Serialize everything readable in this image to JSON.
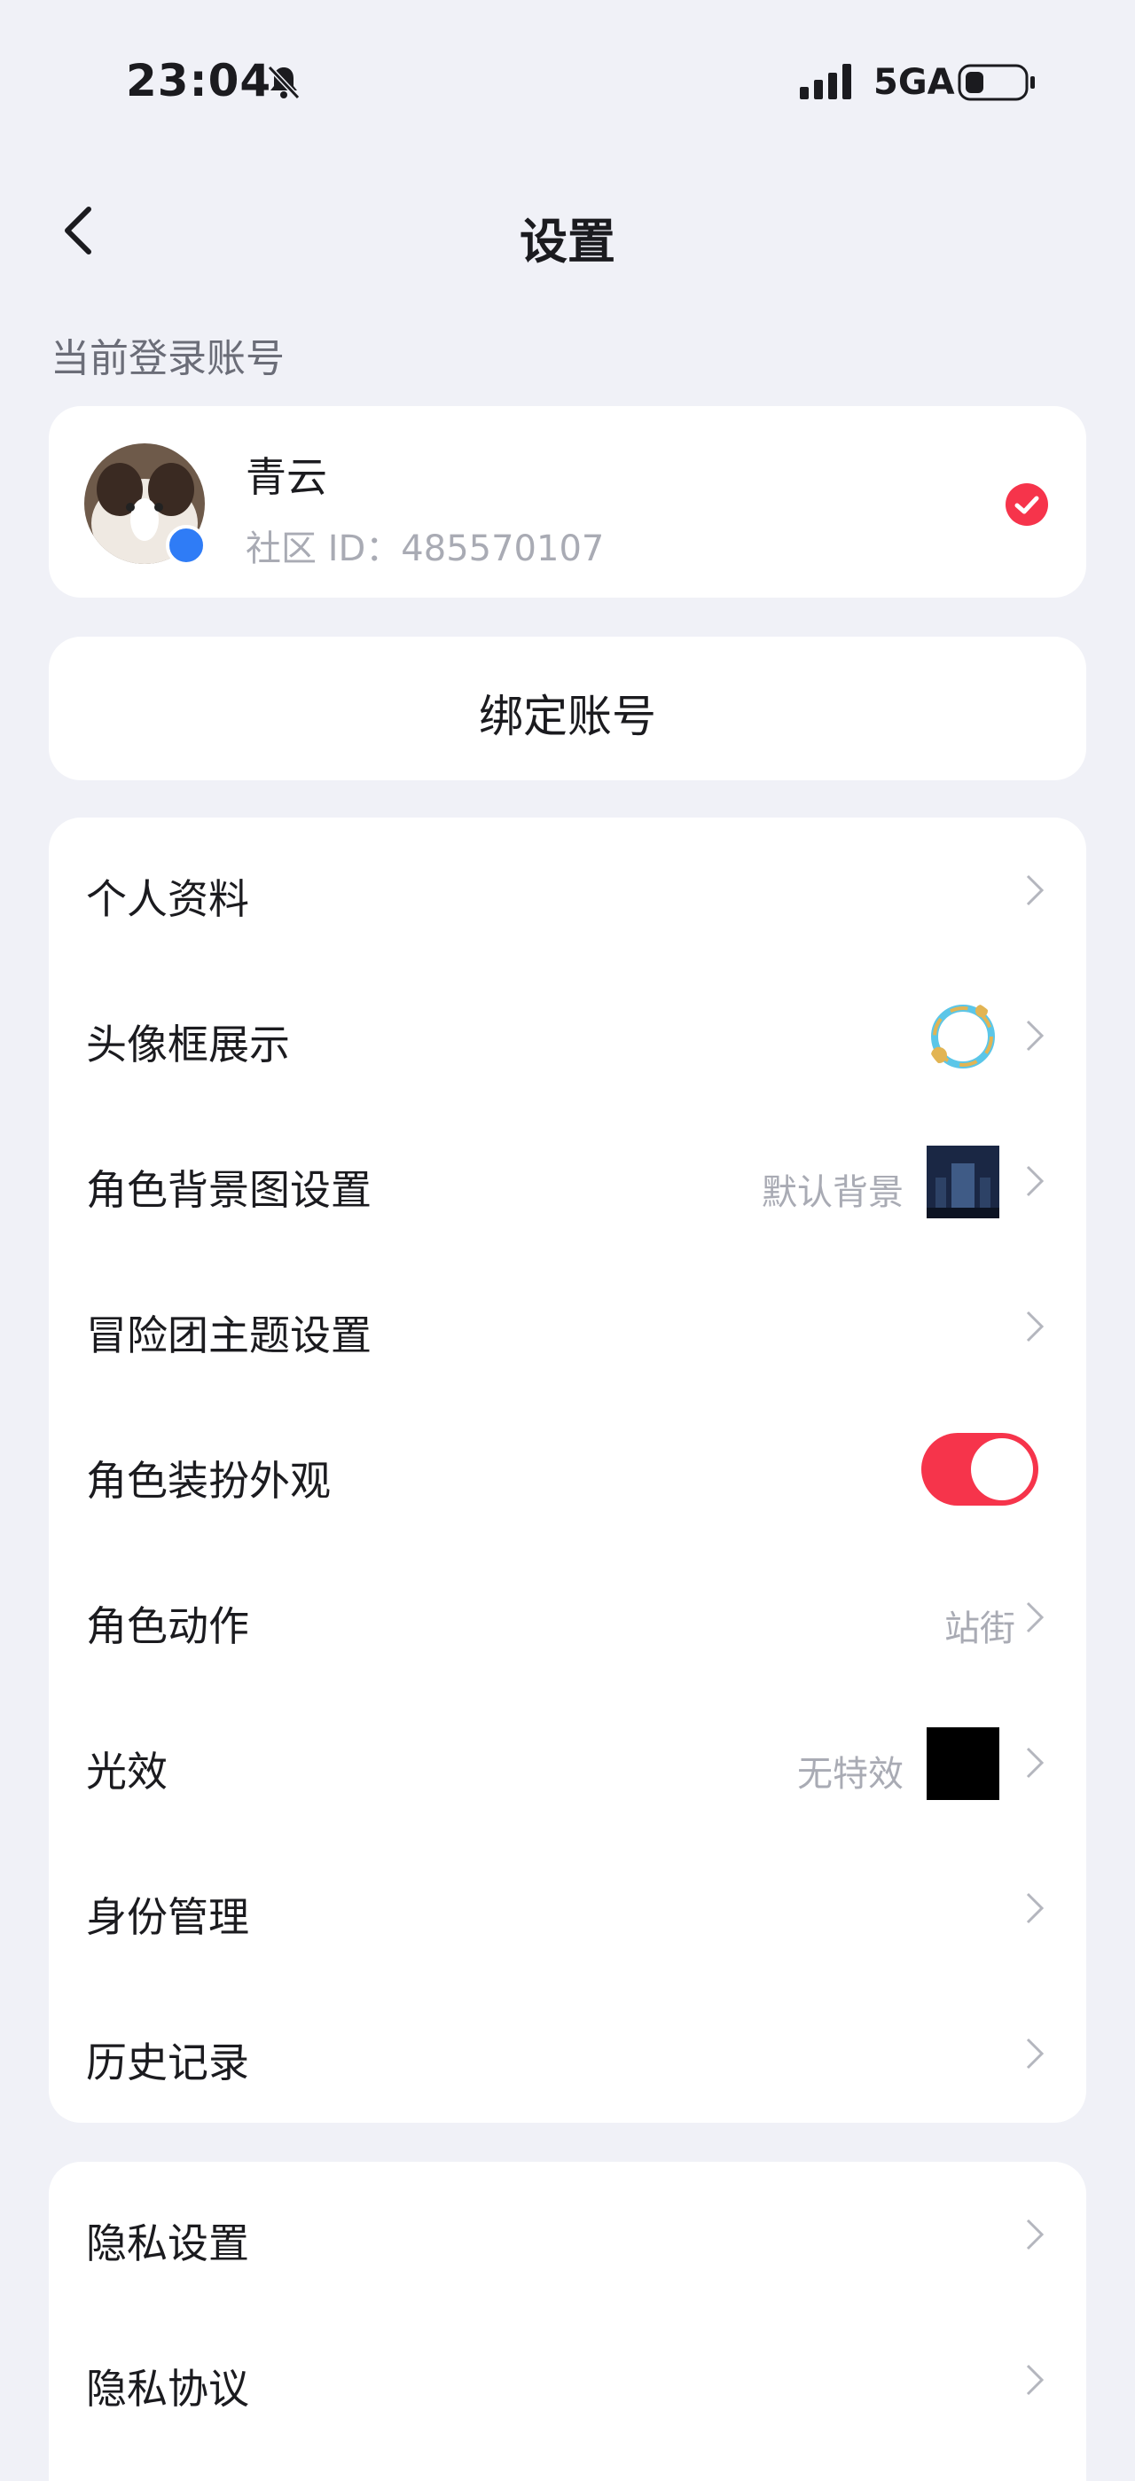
{
  "status_bar": {
    "time": "23:04",
    "network": "5GA"
  },
  "nav": {
    "title": "设置"
  },
  "section": {
    "current_account_label": "当前登录账号"
  },
  "account": {
    "name": "青云",
    "community_id": "社区 ID：485570107"
  },
  "bind": {
    "label": "绑定账号"
  },
  "menu_group_1": [
    {
      "label": "个人资料"
    },
    {
      "label": "头像框展示"
    },
    {
      "label": "角色背景图设置",
      "value": "默认背景"
    },
    {
      "label": "冒险团主题设置"
    },
    {
      "label": "角色装扮外观",
      "toggle_on": true
    },
    {
      "label": "角色动作",
      "value": "站街"
    },
    {
      "label": "光效",
      "value": "无特效"
    },
    {
      "label": "身份管理"
    },
    {
      "label": "历史记录"
    }
  ],
  "menu_group_2": [
    {
      "label": "隐私设置"
    },
    {
      "label": "隐私协议"
    }
  ],
  "colors": {
    "accent": "#f6344b",
    "background": "#f0f1f7",
    "card": "#ffffff",
    "secondary_text": "#a9abb4"
  }
}
